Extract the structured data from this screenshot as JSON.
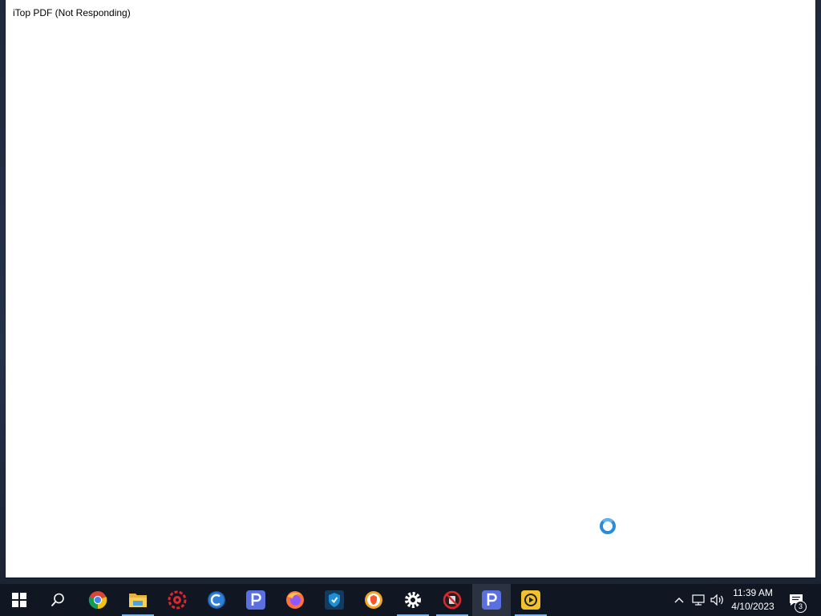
{
  "window": {
    "title": "iTop PDF (Not Responding)"
  },
  "taskbar": {
    "items": [
      {
        "name": "start-icon",
        "state": "normal"
      },
      {
        "name": "search-icon",
        "state": "normal"
      },
      {
        "name": "chrome-icon",
        "state": "normal"
      },
      {
        "name": "file-explorer-icon",
        "state": "running"
      },
      {
        "name": "red-gear-app-icon",
        "state": "normal"
      },
      {
        "name": "ccleaner-icon",
        "state": "normal"
      },
      {
        "name": "itop-pdf-pinned-icon",
        "state": "normal"
      },
      {
        "name": "firefox-icon",
        "state": "normal"
      },
      {
        "name": "shield-vpn-icon",
        "state": "normal"
      },
      {
        "name": "brave-browser-icon",
        "state": "normal"
      },
      {
        "name": "settings-gear-icon",
        "state": "running"
      },
      {
        "name": "no-ads-icon",
        "state": "running"
      },
      {
        "name": "itop-pdf-icon",
        "state": "active"
      },
      {
        "name": "itop-screen-recorder-icon",
        "state": "running"
      }
    ]
  },
  "tray": {
    "time": "11:39 AM",
    "date": "4/10/2023",
    "notification_count": "3"
  },
  "colors": {
    "taskbar": "#101622",
    "window": "#ffffff",
    "spinner": "#2a8bd8",
    "active_indicator": "#7fb4e6"
  }
}
